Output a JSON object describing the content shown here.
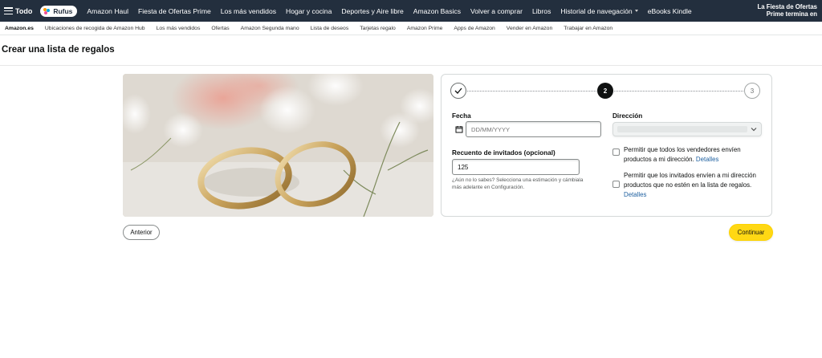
{
  "nav": {
    "all_label": "Todo",
    "rufus_label": "Rufus",
    "links": [
      "Amazon Haul",
      "Fiesta de Ofertas Prime",
      "Los más vendidos",
      "Hogar y cocina",
      "Deportes y Aire libre",
      "Amazon Basics",
      "Volver a comprar",
      "Libros",
      "Historial de navegación",
      "eBooks Kindle"
    ],
    "promo_line1": "La Fiesta de Ofertas",
    "promo_line2": "Prime termina en"
  },
  "subnav": {
    "links": [
      "Amazon.es",
      "Ubicaciones de recogida de Amazon Hub",
      "Los más vendidos",
      "Ofertas",
      "Amazon Segunda mano",
      "Lista de deseos",
      "Tarjetas regalo",
      "Amazon Prime",
      "Apps de Amazon",
      "Vender en Amazon",
      "Trabajar en Amazon"
    ]
  },
  "page": {
    "title": "Crear una lista de regalos"
  },
  "stepper": {
    "active_step": "2",
    "next_step": "3"
  },
  "form": {
    "date_label": "Fecha",
    "date_placeholder": "DD/MM/YYYY",
    "guests_label": "Recuento de invitados (opcional)",
    "guests_value": "125",
    "guests_hint": "¿Aún no lo sabes? Selecciona una estimación y cámbiala más adelante en Configuración.",
    "address_label": "Dirección",
    "check1_text": "Permitir que todos los vendedores envíen productos a mi dirección.",
    "check1_link": "Detalles",
    "check2_text": "Permitir que los invitados envíen a mi dirección productos que no estén en la lista de regalos.",
    "check2_link": "Detalles"
  },
  "buttons": {
    "prev_label": "Anterior",
    "next_label": "Continuar"
  },
  "colors": {
    "nav_bg": "#232f3e",
    "accent_yellow": "#ffd814",
    "link_blue": "#2162a1"
  }
}
